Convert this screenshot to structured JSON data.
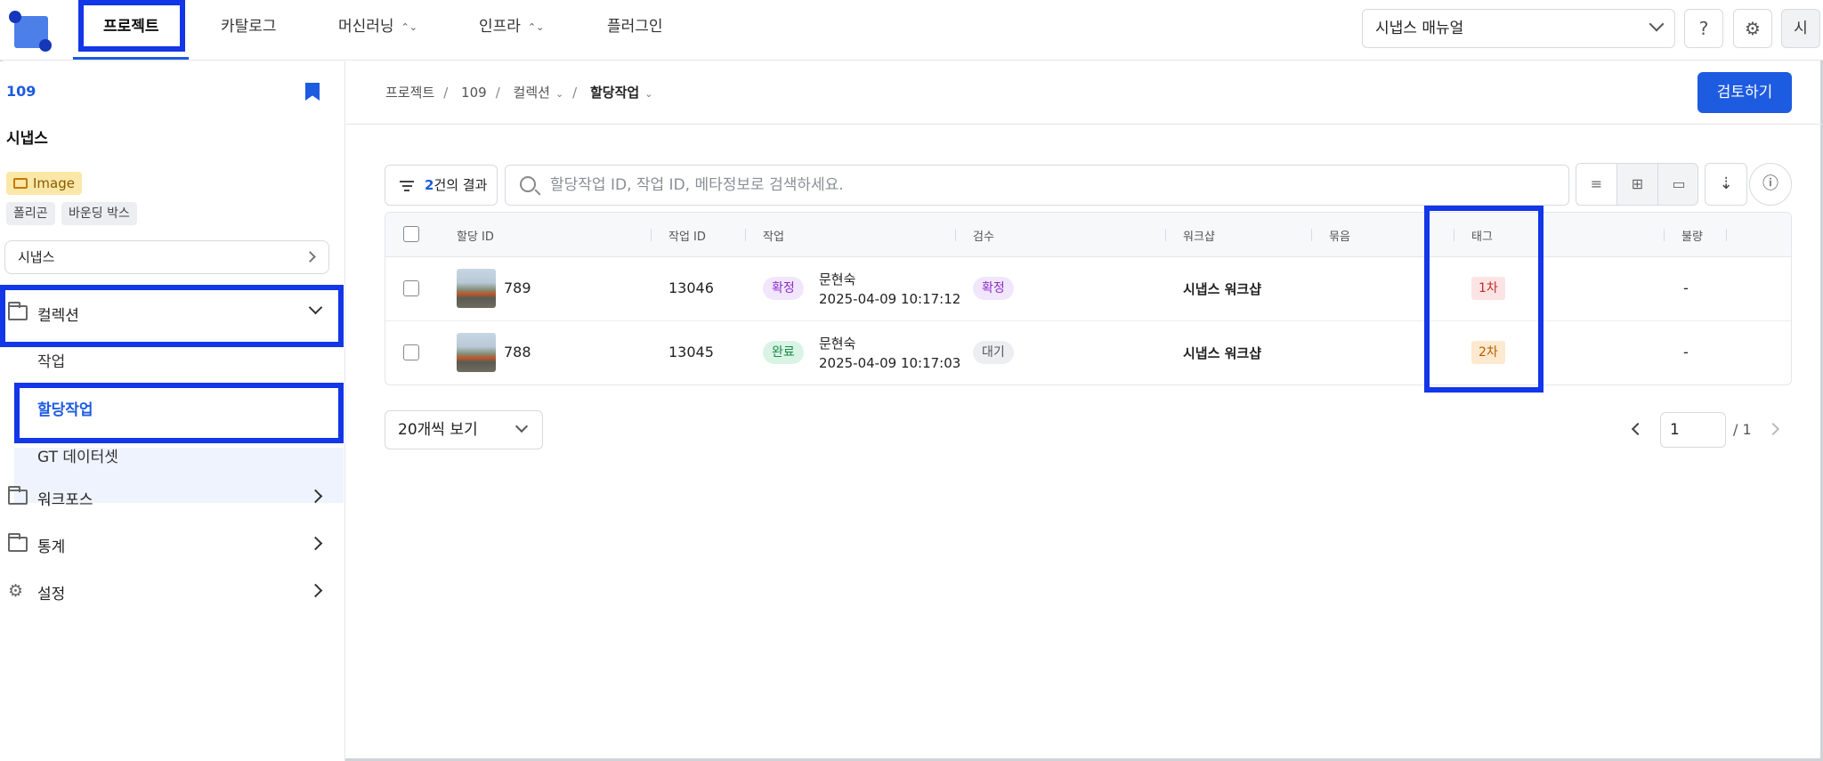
{
  "nav": {
    "items": [
      "프로젝트",
      "카탈로그",
      "머신러닝",
      "인프라",
      "플러그인"
    ],
    "project_select": "시냅스 매뉴얼",
    "avatar": "시"
  },
  "sidebar": {
    "project_id": "109",
    "project_name": "시냅스",
    "data_type": "Image",
    "annotation_tags": [
      "폴리곤",
      "바운딩 박스"
    ],
    "workspace": "시냅스",
    "menu": {
      "collection": "컬렉션",
      "sub": [
        "작업",
        "할당작업",
        "GT 데이터셋"
      ],
      "workforce": "워크포스",
      "stats": "통계",
      "settings": "설정"
    }
  },
  "breadcrumb": [
    "프로젝트",
    "109",
    "컬렉션",
    "할당작업"
  ],
  "review_button": "검토하기",
  "toolbar": {
    "result_count": "2",
    "result_suffix": "건의 결과",
    "search_placeholder": "할당작업 ID, 작업 ID, 메타정보로 검색하세요."
  },
  "table": {
    "columns": [
      "할당 ID",
      "작업 ID",
      "작업",
      "검수",
      "워크샵",
      "묶음",
      "태그",
      "불량"
    ],
    "rows": [
      {
        "assign_id": "789",
        "task_id": "13046",
        "task_status": "확정",
        "worker": "문현숙",
        "time": "2025-04-09 10:17:12",
        "review": "확정",
        "workshop": "시냅스 워크샵",
        "bundle": "",
        "tag": "1차",
        "defect": "-"
      },
      {
        "assign_id": "788",
        "task_id": "13045",
        "task_status": "완료",
        "worker": "문현숙",
        "time": "2025-04-09 10:17:03",
        "review": "대기",
        "workshop": "시냅스 워크샵",
        "bundle": "",
        "tag": "2차",
        "defect": "-"
      }
    ]
  },
  "pagination": {
    "page_size": "20개씩 보기",
    "current_page": "1",
    "total": "/ 1"
  },
  "colors": {
    "accent": "#1d5be0",
    "highlight_box": "#1236e8"
  }
}
